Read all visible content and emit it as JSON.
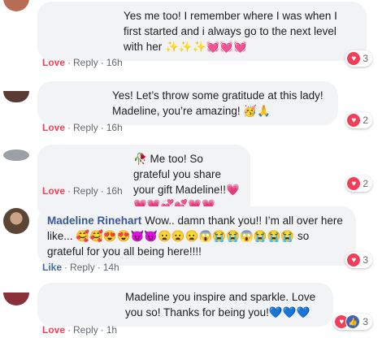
{
  "comments": [
    {
      "author": "",
      "text": "Yes me too! I remember where I was when I first started and i always go to the next level with her ✨✨✨💓💓💓",
      "actions": {
        "react": "Love",
        "reply": "Reply",
        "time": "16h"
      },
      "reactions": {
        "count": "3",
        "types": [
          "heart"
        ]
      }
    },
    {
      "author": "",
      "text": "Yes! Let’s throw some gratitude at this lady! Madeline, you’re amazing! 🥳🙏",
      "actions": {
        "react": "Love",
        "reply": "Reply",
        "time": "16h"
      },
      "reactions": {
        "count": "2",
        "types": [
          "heart"
        ]
      }
    },
    {
      "author": "",
      "text": "🥀 Me too! So grateful you share your gift Madeline!!💗💗💗💞💕💗💗",
      "actions": {
        "react": "Love",
        "reply": "Reply",
        "time": "16h"
      },
      "reactions": {
        "count": "2",
        "types": [
          "heart"
        ]
      }
    },
    {
      "author": "Madeline Rinehart",
      "text": "Wow.. damn thank you!! I’m all over here like... 🥰🥰😍😍😈😈😦😦😦😱😭😭😱😭😭😭 so grateful for you all being here!!!!",
      "actions": {
        "react": "Like",
        "reply": "Reply",
        "time": "14h"
      },
      "reactions": {
        "count": "3",
        "types": [
          "heart"
        ]
      }
    },
    {
      "author": "",
      "text": "Madeline you inspire and sparkle. Love you so! Thanks for being you!💙💙💙",
      "actions": {
        "react": "Love",
        "reply": "Reply",
        "time": "1h"
      },
      "reactions": {
        "count": "3",
        "types": [
          "heart",
          "like"
        ]
      }
    }
  ],
  "colors": {
    "love": "#f33e58",
    "like": "#4267b2",
    "bubble": "#f2f3f5",
    "name": "#385898"
  },
  "separator": "·"
}
